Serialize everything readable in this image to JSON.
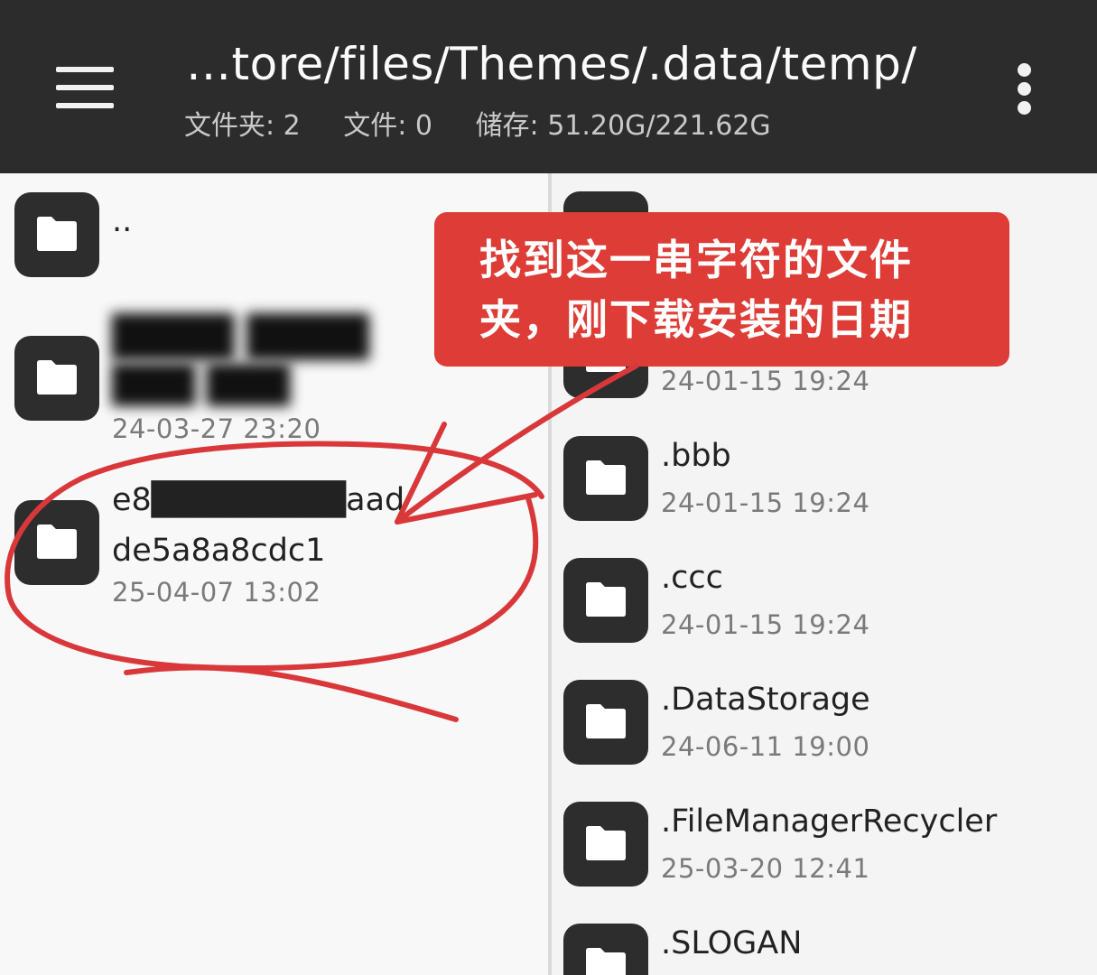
{
  "header": {
    "path": "…tore/files/Themes/.data/temp/",
    "folders": "文件夹: 2",
    "files": "文件: 0",
    "storage": "储存: 51.20G/221.62G"
  },
  "left_pane": {
    "items": [
      {
        "name": ".."
      },
      {
        "name_line1": "████ ████",
        "name_line2": "███ ███",
        "date": "24-03-27  23:20"
      },
      {
        "name_line1": "e8████████aad",
        "name_line2": "de5a8a8cdc1",
        "date": "25-04-07  13:02"
      }
    ]
  },
  "right_pane": {
    "items": [
      {
        "name": "",
        "date": ""
      },
      {
        "name": "",
        "date": "24-01-15  19:24"
      },
      {
        "name": ".bbb",
        "date": "24-01-15  19:24"
      },
      {
        "name": ".ccc",
        "date": "24-01-15  19:24"
      },
      {
        "name": ".DataStorage",
        "date": "24-06-11  19:00"
      },
      {
        "name": ".FileManagerRecycler",
        "date": "25-03-20  12:41"
      },
      {
        "name": ".SLOGAN",
        "date": ""
      }
    ]
  },
  "callout": {
    "line1": "找到这一串字符的文件",
    "line2": "夹，刚下载安装的日期"
  },
  "colors": {
    "header_bg": "#2c2c2c",
    "callout_bg": "#de3c36",
    "annotation_red": "#d9383a",
    "folder_tile": "#2d2d2d"
  },
  "icons": {
    "menu": "hamburger-icon",
    "more": "more-vert-icon",
    "folder": "folder-icon"
  }
}
